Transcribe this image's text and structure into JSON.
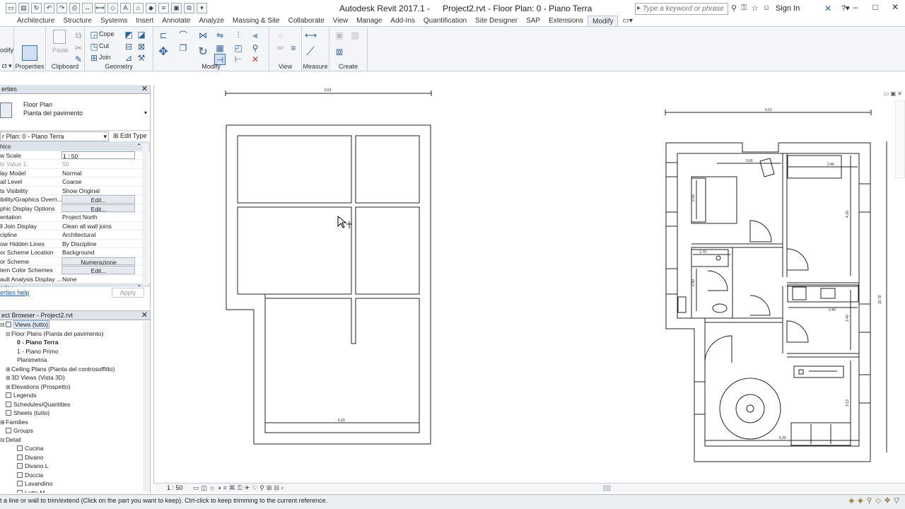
{
  "window": {
    "app_title": "Autodesk Revit 2017.1 -",
    "doc_title": "Project2.rvt - Floor Plan: 0 - Piano Terra",
    "search_placeholder": "Type a keyword or phrase",
    "sign_in": "Sign In"
  },
  "ribbon": {
    "tabs": [
      "Architecture",
      "Structure",
      "Systems",
      "Insert",
      "Annotate",
      "Analyze",
      "Massing & Site",
      "Collaborate",
      "View",
      "Manage",
      "Add-Ins",
      "Quantification",
      "Site Designer",
      "SAP",
      "Extensions",
      "Modify"
    ],
    "active_tab": "Modify",
    "panels": {
      "select": "ct ▾",
      "properties": "Properties",
      "clipboard": "Clipboard",
      "geometry": "Geometry",
      "modify": "Modify",
      "view": "View",
      "measure": "Measure",
      "create": "Create"
    },
    "commands": {
      "modify": "odify",
      "paste": "Paste",
      "cope": "Cope",
      "cut": "Cut",
      "join": "Join"
    }
  },
  "properties": {
    "header": "erties",
    "type_line1": "Floor Plan",
    "type_line2": "Pianta del pavimento",
    "instance": "r Plan: 0 - Piano Terra",
    "edit_type": "Edit Type",
    "rows": [
      {
        "k": "hics",
        "v": "",
        "group": true
      },
      {
        "k": "w Scale",
        "v": "1 : 50",
        "boxed": true
      },
      {
        "k": "le Value  1:",
        "v": "50",
        "grey": true
      },
      {
        "k": "lay Model",
        "v": "Normal"
      },
      {
        "k": "ail Level",
        "v": "Coarse"
      },
      {
        "k": "ts Visibility",
        "v": "Show Original"
      },
      {
        "k": "ibility/Graphics Overri...",
        "v": "Edit...",
        "btn": true
      },
      {
        "k": "phic Display Options",
        "v": "Edit...",
        "btn": true
      },
      {
        "k": "entation",
        "v": "Project North"
      },
      {
        "k": "ll Join Display",
        "v": "Clean all wall joins"
      },
      {
        "k": "cipline",
        "v": "Architectural"
      },
      {
        "k": "ow Hidden Lines",
        "v": "By Discipline"
      },
      {
        "k": "or Scheme Location",
        "v": "Background"
      },
      {
        "k": "or Scheme",
        "v": "Numerazione",
        "btn": true
      },
      {
        "k": "tem Color Schemes",
        "v": "Edit...",
        "btn": true
      },
      {
        "k": "ault Analysis Display ...",
        "v": "None"
      },
      {
        "k": "erlay",
        "v": "",
        "group": true
      }
    ],
    "help": "erties help",
    "apply": "Apply"
  },
  "browser": {
    "header": "ect Browser - Project2.rvt",
    "nodes": [
      {
        "label": "Views (tutto)",
        "indent": 0,
        "toggle": "-",
        "icon": true,
        "hi": true
      },
      {
        "label": "Floor Plans (Pianta del pavimento)",
        "indent": 1,
        "toggle": "-"
      },
      {
        "label": "0 - Piano Terra",
        "indent": 2,
        "sel": true
      },
      {
        "label": "1 - Piano Primo",
        "indent": 2
      },
      {
        "label": "Planimetria",
        "indent": 2
      },
      {
        "label": "Ceiling Plans (Pianta del controsoffitto)",
        "indent": 1,
        "toggle": "+"
      },
      {
        "label": "3D Views (Vista 3D)",
        "indent": 1,
        "toggle": "+"
      },
      {
        "label": "Elevations (Prospetto)",
        "indent": 1,
        "toggle": "+"
      },
      {
        "label": "Legends",
        "indent": 0,
        "icon": true
      },
      {
        "label": "Schedules/Quantities",
        "indent": 0,
        "icon": true
      },
      {
        "label": "Sheets (tutto)",
        "indent": 0,
        "icon": true
      },
      {
        "label": "Families",
        "indent": 0,
        "toggle": "+"
      },
      {
        "label": "Groups",
        "indent": 0,
        "icon": true
      },
      {
        "label": "Detail",
        "indent": 0,
        "toggle": "-"
      },
      {
        "label": "Cucina",
        "indent": 2,
        "icon": true
      },
      {
        "label": "Divano",
        "indent": 2,
        "icon": true
      },
      {
        "label": "Divano L",
        "indent": 2,
        "icon": true
      },
      {
        "label": "Doccia",
        "indent": 2,
        "icon": true
      },
      {
        "label": "Lavandino",
        "indent": 2,
        "icon": true
      },
      {
        "label": "Letto M",
        "indent": 2,
        "icon": true
      }
    ]
  },
  "drawing": {
    "dims": {
      "left_top": "6.51",
      "left_bottom": "6.20",
      "right_top": "6.51",
      "right_side": "10.79",
      "r1": "3.66",
      "r2": "2.46",
      "r3": "1.70",
      "r4": "2.40",
      "r5": "6.20",
      "r6": "3.13",
      "r7": "2.40",
      "r8": "4.20",
      "r9": "3.30",
      "r10": "2.40"
    }
  },
  "viewbar": {
    "scale": "1 : 50"
  },
  "status": {
    "text": "t a line or wall to trim/extend (Click on the part you want to keep). Ctrl-click to keep trimming to the current reference."
  }
}
